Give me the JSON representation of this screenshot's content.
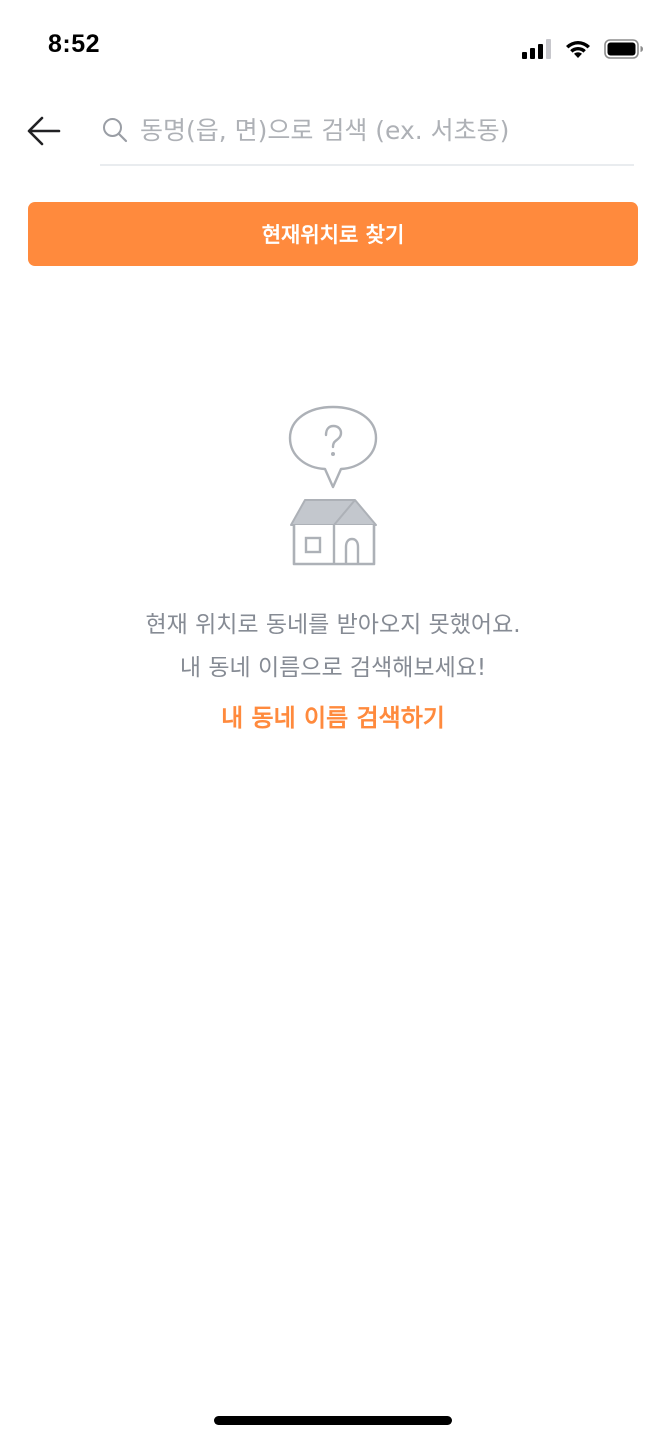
{
  "status_bar": {
    "time": "8:52",
    "icons": [
      "cellular-signal-icon",
      "wifi-icon",
      "battery-icon"
    ]
  },
  "header": {
    "back_icon": "arrow-left-icon",
    "search": {
      "icon": "search-icon",
      "value": "",
      "placeholder": "동명(읍, 면)으로 검색 (ex. 서초동)"
    }
  },
  "location_button": {
    "label": "현재위치로 찾기"
  },
  "empty_state": {
    "illustration": "house-question-icon",
    "message_lines": [
      "현재 위치로 동네를 받아오지 못했어요.",
      "내 동네 이름으로 검색해보세요!"
    ],
    "link_label": "내 동네 이름 검색하기"
  },
  "colors": {
    "accent": "#ff8a3d",
    "message_text": "#868b94",
    "placeholder": "#aeb1b6",
    "divider": "#e9ecef",
    "illustration": "#adb1b7"
  }
}
